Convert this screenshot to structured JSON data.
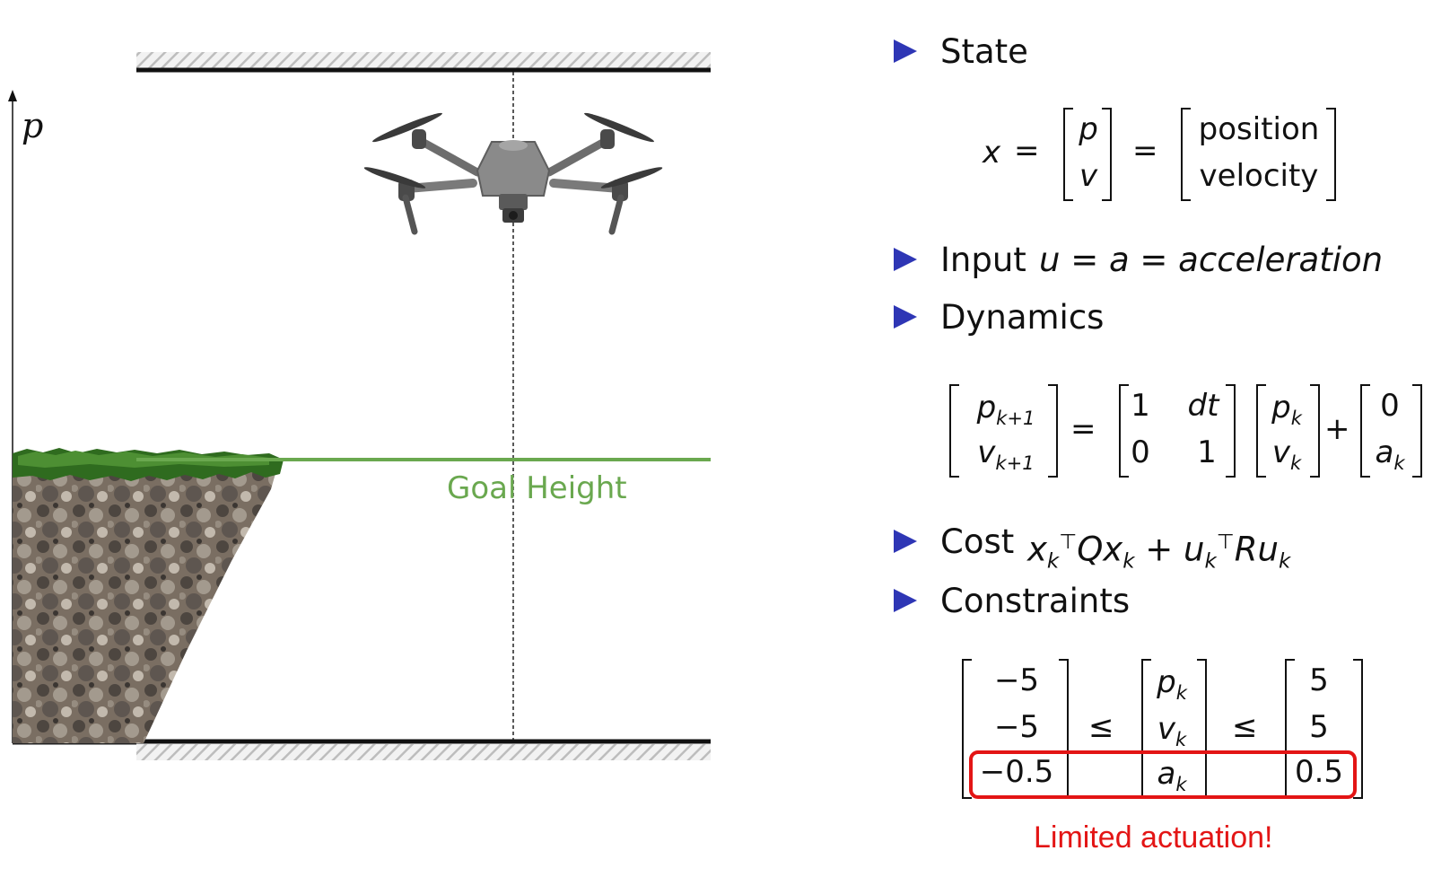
{
  "diagram": {
    "axis_label": "p",
    "goal_label": "Goal Height",
    "colors": {
      "goal": "#6aa84f",
      "bullet": "#2e36b5",
      "highlight": "#e31515",
      "wall": "#111111"
    }
  },
  "slide": {
    "items": [
      {
        "label": "State"
      },
      {
        "label": "Input",
        "math": "u = a = acceleration"
      },
      {
        "label": "Dynamics"
      },
      {
        "label": "Cost",
        "math": "x_k^T Q x_k + u_k^T R u_k"
      },
      {
        "label": "Constraints"
      }
    ],
    "state_eq": {
      "lhs": "x",
      "vec": [
        "p",
        "v"
      ],
      "named": [
        "position",
        "velocity"
      ]
    },
    "dynamics_eq": {
      "lhs": [
        "p_{k+1}",
        "v_{k+1}"
      ],
      "A": [
        [
          "1",
          "dt"
        ],
        [
          "0",
          "1"
        ]
      ],
      "x": [
        "p_k",
        "v_k"
      ],
      "B": [
        "0",
        "a_k"
      ]
    },
    "constraints": {
      "lower": [
        "−5",
        "−5",
        "−0.5"
      ],
      "mid": [
        "p_k",
        "v_k",
        "a_k"
      ],
      "upper": [
        "5",
        "5",
        "0.5"
      ],
      "relation": "≤"
    },
    "callout": "Limited actuation!"
  }
}
